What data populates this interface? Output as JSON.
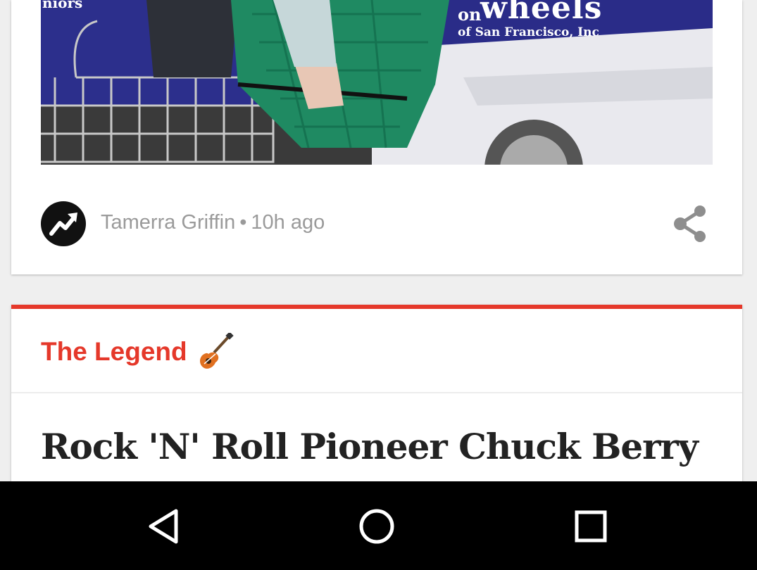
{
  "feed": {
    "card_one": {
      "image": {
        "van_text_niors": "niors",
        "van_text_on": "on",
        "van_text_wheels": "wheels",
        "van_text_city": "of San Francisco, Inc"
      },
      "byline": {
        "author": "Tamerra Griffin",
        "separator": "•",
        "time": "10h ago",
        "avatar_icon": "trending-icon",
        "share_icon": "share-icon"
      }
    },
    "card_two": {
      "category": "The Legend",
      "category_icon": "guitar-icon",
      "accent_color": "#e5382a",
      "headline": "Rock 'N' Roll Pioneer Chuck Berry"
    }
  },
  "nav_bar": {
    "back_icon": "back-triangle-icon",
    "home_icon": "home-circle-icon",
    "recents_icon": "recents-square-icon"
  }
}
